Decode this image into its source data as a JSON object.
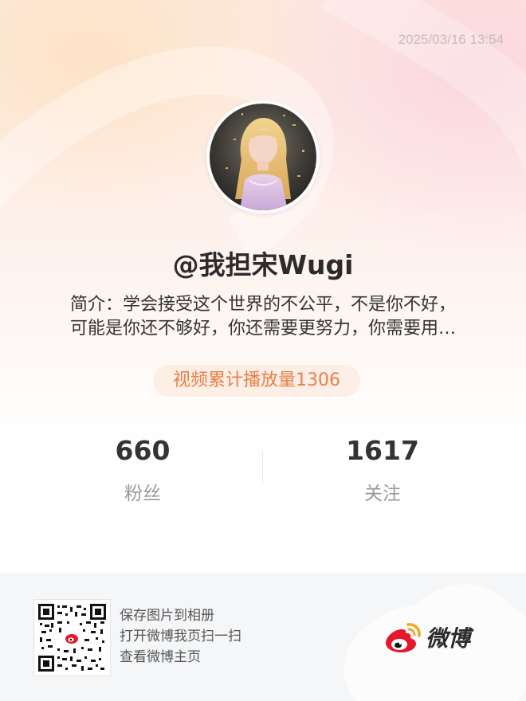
{
  "timestamp": "2025/03/16 13:54",
  "profile": {
    "username": "@我担宋Wugi",
    "bio_line1": "简介：学会接受这个世界的不公平，不是你不好，",
    "bio_line2": "可能是你还不够好，你还需要更努力，你需要用…",
    "plays_badge": "视频累计播放量1306"
  },
  "stats": {
    "followers_value": "660",
    "followers_label": "粉丝",
    "following_value": "1617",
    "following_label": "关注"
  },
  "footer": {
    "line1": "保存图片到相册",
    "line2": "打开微博我页扫一扫",
    "line3": "查看微博主页",
    "brand": "微博"
  },
  "colors": {
    "accent_orange": "#e8804a",
    "badge_bg": "#fdeee6",
    "weibo_red": "#e6162d"
  },
  "icons": {
    "avatar": "avatar-photo",
    "qr": "qr-code-icon",
    "logo": "weibo-logo-icon"
  }
}
